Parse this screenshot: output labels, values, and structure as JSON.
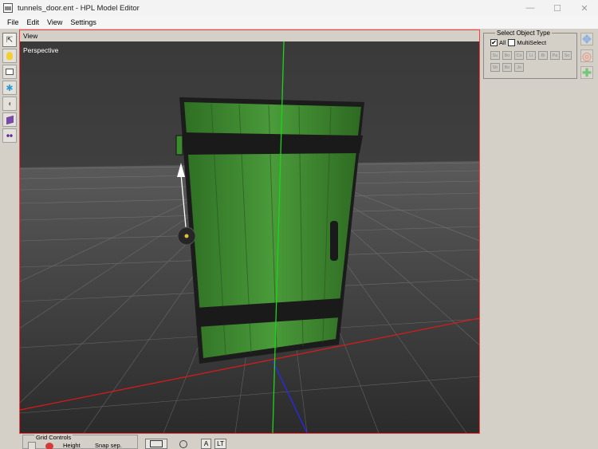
{
  "window": {
    "title": "tunnels_door.ent - HPL Model Editor",
    "controls": {
      "minimize": "—",
      "maximize": "☐",
      "close": "✕"
    }
  },
  "menubar": {
    "items": [
      "File",
      "Edit",
      "View",
      "Settings"
    ]
  },
  "left_toolbar": {
    "tools": [
      {
        "name": "select-tool",
        "glyph": "⇱"
      },
      {
        "name": "light-tool",
        "glyph": "💡"
      },
      {
        "name": "billboard-tool",
        "glyph": "▭"
      },
      {
        "name": "particle-tool",
        "glyph": "✱"
      },
      {
        "name": "sound-tool",
        "glyph": "◖"
      },
      {
        "name": "primitive-tool",
        "glyph": "▰"
      },
      {
        "name": "joint-tool",
        "glyph": "⦁⦁"
      }
    ]
  },
  "viewport": {
    "header": "View",
    "mode_label": "Perspective",
    "border_color": "#ff3b3b",
    "background": "#3d3d3d",
    "door_color": "#3c8a2e",
    "axis_colors": {
      "x": "#e01919",
      "y": "#19d619",
      "z": "#2828ff"
    }
  },
  "right_panel": {
    "group_title": "Select Object Type",
    "all_label": "All",
    "all_checked": true,
    "multiselect_label": "MultiSelect",
    "multiselect_checked": false,
    "type_buttons": [
      "Su",
      "Bo",
      "Co",
      "Li",
      "Bi",
      "Pa",
      "So",
      "Sh",
      "Bo",
      "Jo"
    ],
    "side_actions": [
      {
        "name": "translate-icon",
        "glyph": "✥",
        "color": "#8fb3e0"
      },
      {
        "name": "rotate-icon",
        "glyph": "◎",
        "color": "#e9a18f"
      },
      {
        "name": "scale-icon",
        "glyph": "✚",
        "color": "#74c779"
      }
    ]
  },
  "bottom_bar": {
    "grid_controls_title": "Grid Controls",
    "height_label": "Height",
    "snap_label": "Snap sep.",
    "button_a": "A",
    "button_lt": "LT"
  }
}
